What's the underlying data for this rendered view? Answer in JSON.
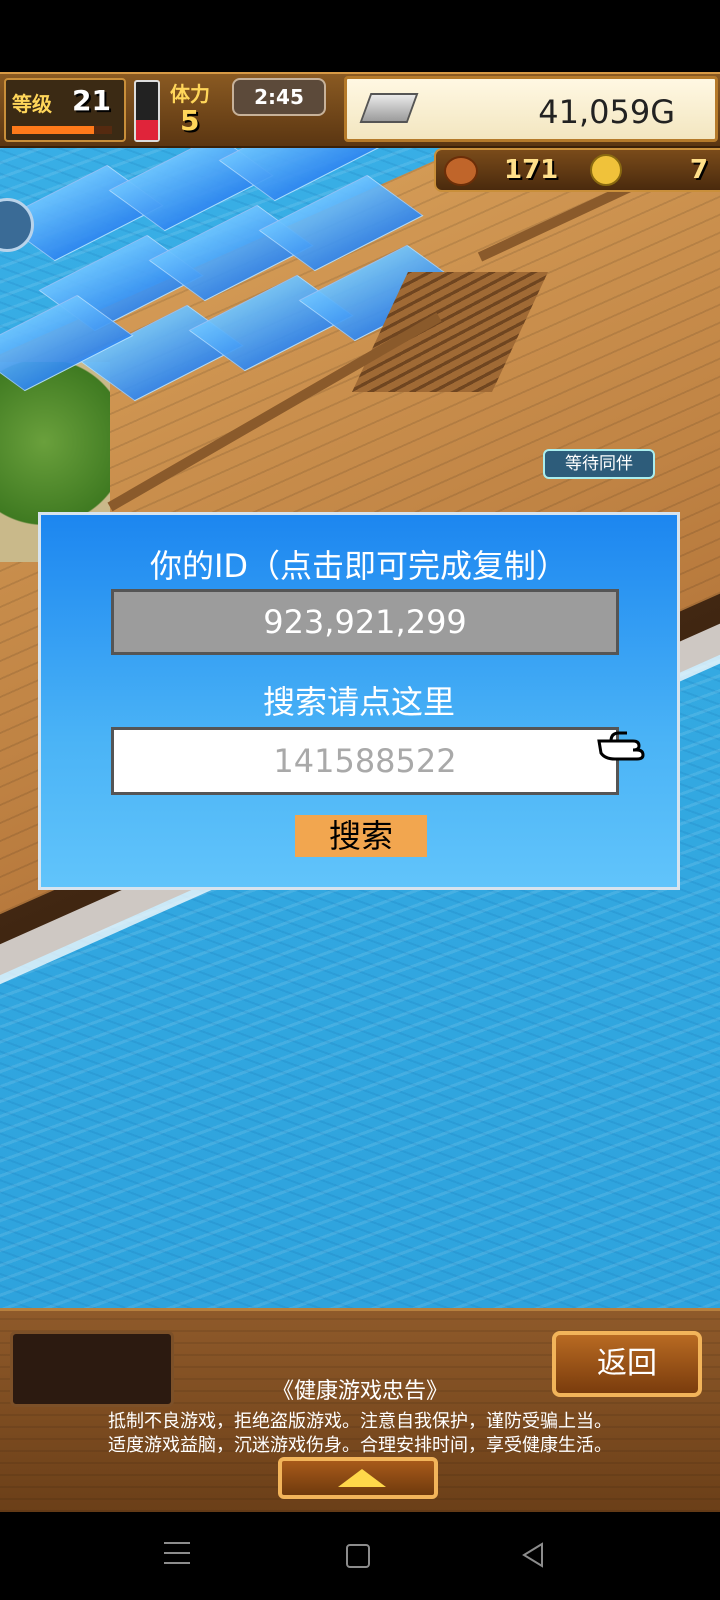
{
  "hud": {
    "level_label": "等级",
    "level_value": "21",
    "exp_progress": 0.82,
    "hp_level": 0.35,
    "stamina_label": "体力",
    "stamina_value": "5",
    "timer": "2:45",
    "gold": "41,059G",
    "gold_icon": "silver-bar-icon"
  },
  "resources": {
    "food_value": "171",
    "medal_value": "7",
    "food_icon": "meat-icon",
    "medal_icon": "gold-medal-icon"
  },
  "scene": {
    "npc_tag": "等待同伴"
  },
  "dialog": {
    "title": "你的ID（点击即可完成复制）",
    "id_value": "923,921,299",
    "search_hint": "搜索请点这里",
    "search_placeholder": "141588522",
    "search_button": "搜索"
  },
  "bottom": {
    "back_button": "返回",
    "advice_title": "《健康游戏忠告》",
    "advice_line1": "抵制不良游戏，拒绝盗版游戏。注意自我保护，谨防受骗上当。",
    "advice_line2": "适度游戏益脑，沉迷游戏伤身。合理安排时间，享受健康生活。"
  },
  "colors": {
    "dialog_top": "#1c86f0",
    "dialog_bottom": "#61c4fb",
    "search_button": "#f2a64f",
    "gold_text": "#222222"
  }
}
